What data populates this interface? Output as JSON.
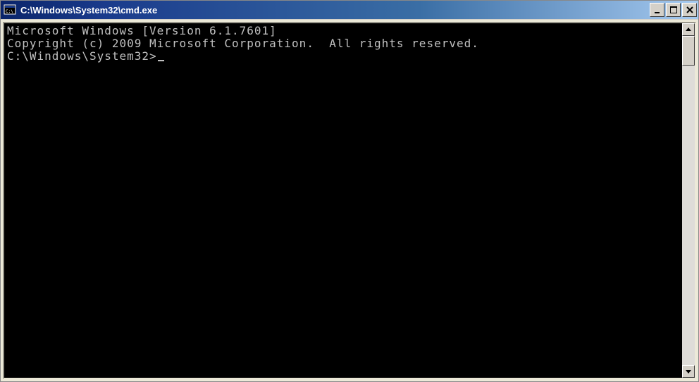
{
  "window": {
    "title": "C:\\Windows\\System32\\cmd.exe"
  },
  "console": {
    "lines": [
      "Microsoft Windows [Version 6.1.7601]",
      "Copyright (c) 2009 Microsoft Corporation.  All rights reserved.",
      "",
      "C:\\Windows\\System32>"
    ],
    "prompt": "C:\\Windows\\System32>"
  }
}
